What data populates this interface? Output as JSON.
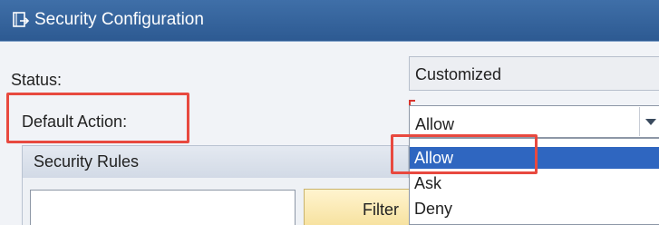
{
  "window": {
    "title": "Security Configuration",
    "icon": "window-icon"
  },
  "form": {
    "status_label": "Status:",
    "status_value": "Customized",
    "default_action_label": "Default Action:",
    "default_action_value": "Allow"
  },
  "dropdown": {
    "options": [
      "Allow",
      "Ask",
      "Deny"
    ],
    "selected": "Allow",
    "selected_color": "#2f66c0"
  },
  "security_rules": {
    "title": "Security Rules",
    "filter_input_value": "",
    "filter_button_label": "Filter"
  },
  "colors": {
    "titlebar": "#2d5a92",
    "highlight": "#e8493f",
    "filter_button": "#f7e2a0"
  }
}
